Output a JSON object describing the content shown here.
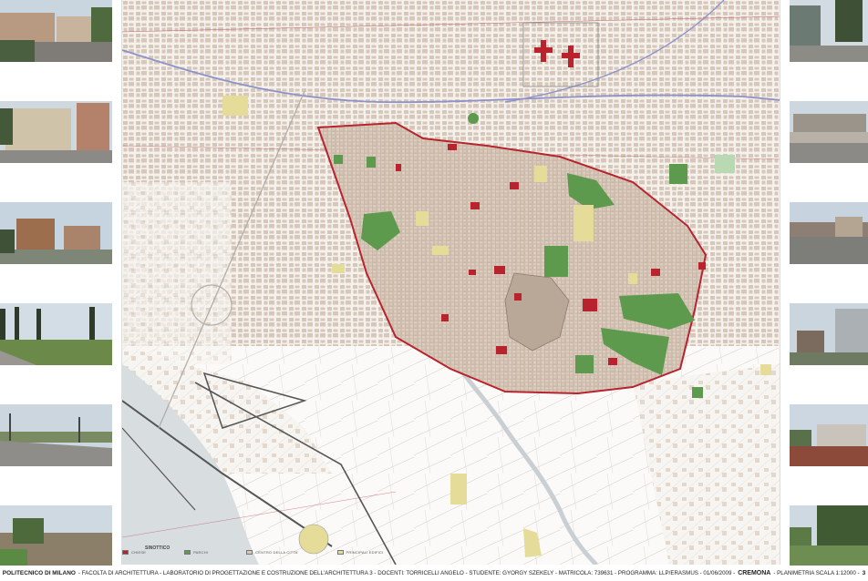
{
  "legend": [
    {
      "label": "CHIESE",
      "color": "#b8232d"
    },
    {
      "label": "PARCHI",
      "color": "#5e9a4e"
    },
    {
      "label": "CENTRO DELLA CITTA'",
      "color": "#d6c7b9"
    },
    {
      "label": "PRINCIPALI EDIFICI",
      "color": "#e6dc9a"
    }
  ],
  "synoptic_label": "SINOTTICO",
  "footer": {
    "institution": "POLITECNICO DI MILANO",
    "details": "- FACOLTA DI ARCHITETTURA - LABORATORIO DI PROGETTAZIONE E COSTRUZIONE DELL'ARCHITETTURA 3 - DOCENTI: TORRICELLI ANGELO - STUDENTE: GYORGY SZEKELY - MATRICOLA: 739631 - PROGRAMMA: LLP/ERASMUS - 01/06/2009 -",
    "city": "CREMONA",
    "plan": "- PLANIMETRIA SCALA 1:12000 -",
    "page": "3"
  },
  "colors": {
    "city_outline": "#b8232d",
    "railway": "#8f92c8",
    "blocks": "#d6c7b9",
    "parks": "#5e9a4e",
    "key_buildings": "#e6dc9a",
    "river": "#d8dde0"
  },
  "photos_left": [
    "street-with-buildings",
    "residential-building",
    "brick-villa",
    "trees-and-field",
    "road-and-fields",
    "rural-field"
  ],
  "photos_right": [
    "industrial-building",
    "low-buildings",
    "town-road",
    "modern-building",
    "apartment-blocks",
    "park-with-trees"
  ]
}
